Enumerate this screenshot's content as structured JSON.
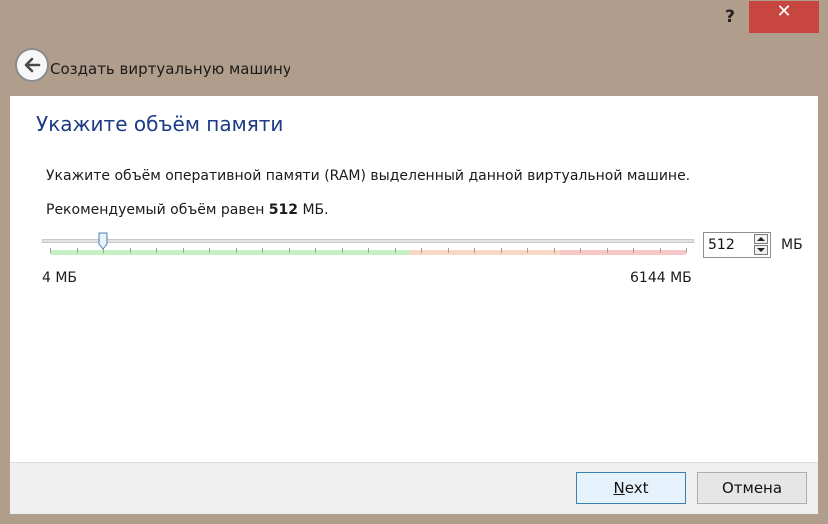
{
  "window": {
    "help_label": "?",
    "close_label": "✕",
    "close_color": "#c7463f"
  },
  "wizard": {
    "title": "Создать виртуальную машину",
    "back_icon": "back-arrow-icon"
  },
  "page": {
    "title": "Укажите объём памяти",
    "description": "Укажите объём оперативной памяти (RAM) выделенный данной виртуальной машине.",
    "recommend_prefix": "Рекомендуемый объём равен ",
    "recommend_value": "512",
    "recommend_suffix": " МБ."
  },
  "memory": {
    "min_label": "4 МБ",
    "max_label": "6144 МБ",
    "min_mb": 4,
    "max_mb": 6144,
    "current_mb": 512,
    "value": "512",
    "unit": "МБ"
  },
  "buttons": {
    "next_mnemonic": "N",
    "next_rest": "ext",
    "cancel": "Отмена"
  },
  "colors": {
    "title_blue": "#1d3a87",
    "zone_green": "#c6f0c4",
    "zone_orange": "#f9d8c6",
    "zone_red": "#f8c8c8"
  }
}
